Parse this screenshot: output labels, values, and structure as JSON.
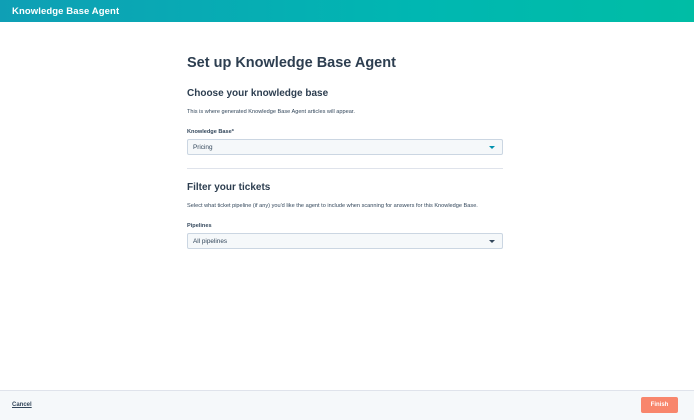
{
  "header": {
    "title": "Knowledge Base Agent"
  },
  "main": {
    "title": "Set up Knowledge Base Agent",
    "knowledge_section": {
      "title": "Choose your knowledge base",
      "description": "This is where generated Knowledge Base Agent articles will appear.",
      "field_label": "Knowledge Base*",
      "selected_value": "Pricing"
    },
    "tickets_section": {
      "title": "Filter your tickets",
      "description": "Select what ticket pipeline (if any) you'd like the agent to include when scanning for answers for this Knowledge Base.",
      "field_label": "Pipelines",
      "selected_value": "All pipelines"
    }
  },
  "footer": {
    "cancel_label": "Cancel",
    "finish_label": "Finish"
  },
  "colors": {
    "header_gradient_start": "#0f9fb5",
    "header_gradient_end": "#00bda5",
    "finish_button": "#f8866c",
    "text_primary": "#33475b",
    "select_background": "#f5f8fa",
    "select_border": "#cbd6e2"
  },
  "icons": {
    "knowledge_select_caret": "caret-down-icon",
    "pipelines_select_caret": "caret-down-icon"
  }
}
